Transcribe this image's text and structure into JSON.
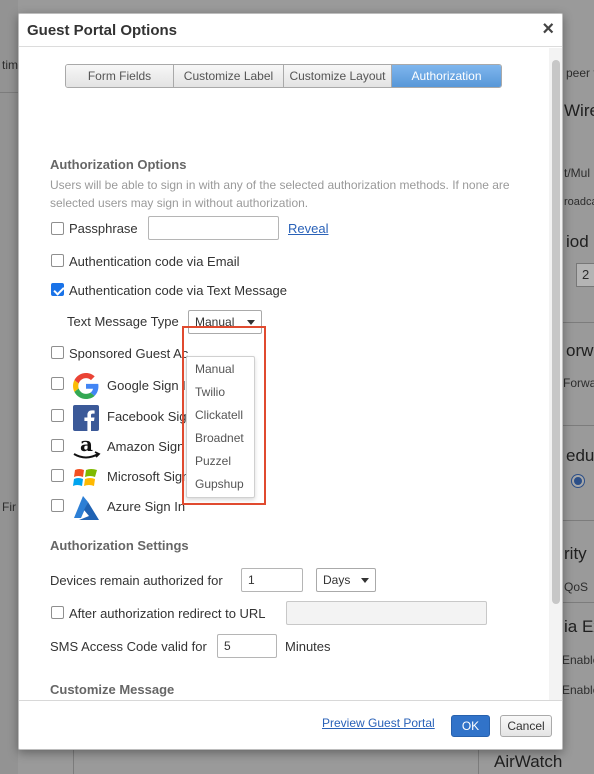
{
  "background": {
    "fragments": [
      "peer to",
      "Wire",
      "t/Mul",
      "roadca",
      "iod",
      "2",
      "orw",
      "Forwa",
      "edul",
      "rity",
      "QoS",
      "ia Ex",
      "Enable",
      "Enable",
      "AirWatch",
      "time",
      "Fir"
    ]
  },
  "modal": {
    "title": "Guest Portal Options",
    "close_glyph": "×",
    "tabs": [
      {
        "label": "Form Fields",
        "active": false
      },
      {
        "label": "Customize Label",
        "active": false
      },
      {
        "label": "Customize Layout",
        "active": false
      },
      {
        "label": "Authorization",
        "active": true
      }
    ],
    "auth_options": {
      "title": "Authorization Options",
      "description": "Users will be able to sign in with any of the selected authorization methods. If none are selected users may sign in without authorization.",
      "passphrase": {
        "label": "Passphrase",
        "checked": false,
        "value": "",
        "reveal_label": "Reveal"
      },
      "email_code": {
        "label": "Authentication code via Email",
        "checked": false
      },
      "text_code": {
        "label": "Authentication code via Text Message",
        "checked": true
      },
      "text_message_type": {
        "label": "Text Message Type",
        "selected": "Manual",
        "options": [
          "Manual",
          "Twilio",
          "Clickatell",
          "Broadnet",
          "Puzzel",
          "Gupshup"
        ]
      },
      "sponsored": {
        "label": "Sponsored Guest Ac",
        "checked": false
      },
      "google": {
        "label": "Google Sign In",
        "checked": false,
        "icon": "google-icon"
      },
      "facebook": {
        "label": "Facebook Sign",
        "checked": false,
        "icon": "facebook-icon"
      },
      "amazon": {
        "label": "Amazon Sign",
        "checked": false,
        "icon": "amazon-icon"
      },
      "microsoft": {
        "label": "Microsoft Sign In",
        "checked": false,
        "icon": "microsoft-icon"
      },
      "azure": {
        "label": "Azure Sign In",
        "checked": false,
        "icon": "azure-icon"
      }
    },
    "auth_settings": {
      "title": "Authorization Settings",
      "devices_label": "Devices remain authorized for",
      "devices_value": "1",
      "devices_unit": "Days",
      "redirect_label": "After authorization redirect to URL",
      "redirect_checked": false,
      "redirect_value": "",
      "sms_label": "SMS Access Code valid for",
      "sms_value": "5",
      "sms_unit": "Minutes"
    },
    "customize_message": {
      "title": "Customize Message"
    },
    "footer": {
      "preview_link": "Preview Guest Portal",
      "ok": "OK",
      "cancel": "Cancel"
    }
  },
  "colors": {
    "accent": "#3173c9",
    "active_tab": "#5797d8",
    "highlight_border": "#e04a2f",
    "link": "#2a62b8"
  }
}
